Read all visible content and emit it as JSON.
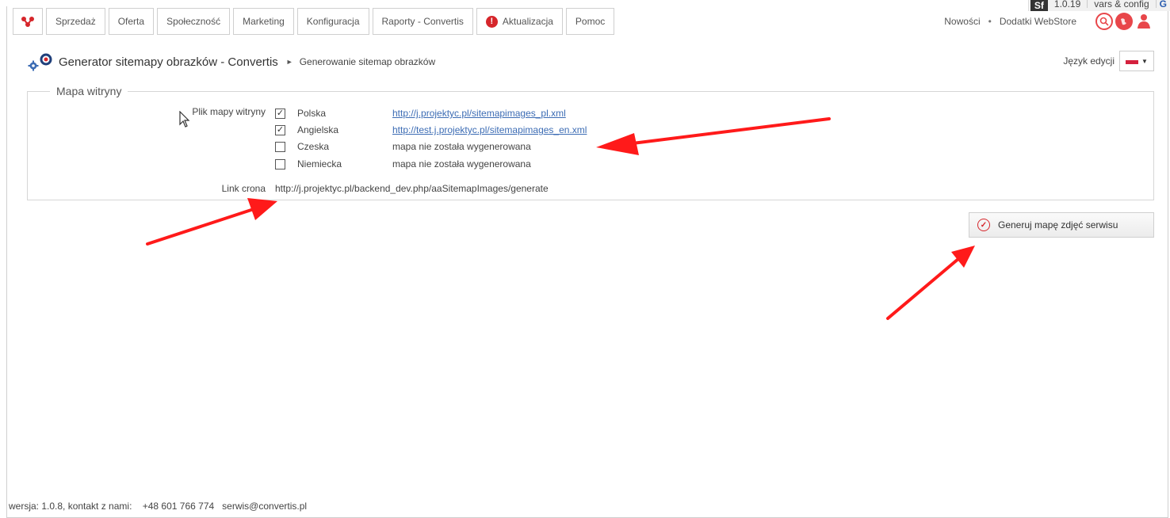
{
  "debugbar": {
    "sf_label": "Sf",
    "version": "1.0.19",
    "vars": "vars & config",
    "extra_icon": "G"
  },
  "nav": {
    "items": [
      {
        "label": "Sprzedaż"
      },
      {
        "label": "Oferta"
      },
      {
        "label": "Społeczność"
      },
      {
        "label": "Marketing"
      },
      {
        "label": "Konfiguracja"
      },
      {
        "label": "Raporty - Convertis"
      },
      {
        "label": "Aktualizacja",
        "alert_icon": "!"
      },
      {
        "label": "Pomoc"
      }
    ]
  },
  "topright": {
    "news": "Nowości",
    "separator": "•",
    "addons": "Dodatki WebStore"
  },
  "header": {
    "title": "Generator sitemapy obrazków - Convertis",
    "separator": "►",
    "subtitle": "Generowanie sitemap obrazków"
  },
  "language": {
    "label": "Język edycji"
  },
  "sitemap": {
    "legend": "Mapa witryny",
    "file_label": "Plik mapy witryny",
    "entries": [
      {
        "language": "Polska",
        "checked": true,
        "value": "http://j.projektyc.pl/sitemapimages_pl.xml",
        "is_link": true
      },
      {
        "language": "Angielska",
        "checked": true,
        "value": "http://test.j.projektyc.pl/sitemapimages_en.xml",
        "is_link": true
      },
      {
        "language": "Czeska",
        "checked": false,
        "value": "mapa nie została wygenerowana",
        "is_link": false
      },
      {
        "language": "Niemiecka",
        "checked": false,
        "value": "mapa nie została wygenerowana",
        "is_link": false
      }
    ],
    "checkmark": "✓",
    "cron_label": "Link crona",
    "cron_value": "http://j.projektyc.pl/backend_dev.php/aaSitemapImages/generate"
  },
  "actions": {
    "generate_label": "Generuj mapę zdjęć serwisu",
    "generate_icon": "check-circle-icon"
  },
  "footer": {
    "text": "wersja: 1.0.8, kontakt z nami:    +48 601 766 774   serwis@convertis.pl"
  },
  "colors": {
    "accent_red": "#d6262b",
    "link_blue": "#3c6cb4",
    "annotation_red": "#ff1a1a"
  }
}
